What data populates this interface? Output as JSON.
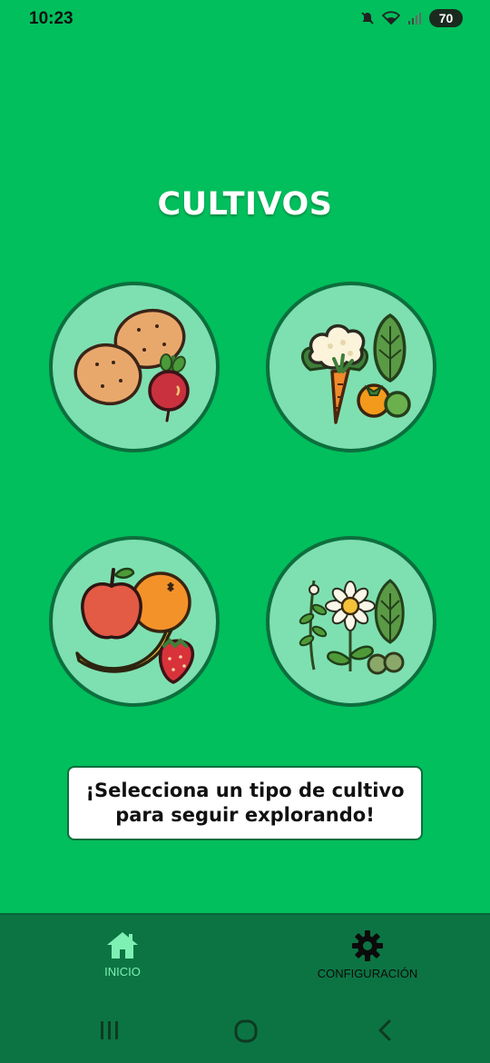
{
  "status_bar": {
    "time": "10:23",
    "battery": "70"
  },
  "page": {
    "title": "CULTIVOS",
    "message": "¡Selecciona un tipo de cultivo para seguir explorando!"
  },
  "categories": [
    {
      "id": "tuberculos",
      "icon": "potatoes-beet-icon"
    },
    {
      "id": "hortalizas",
      "icon": "vegetables-icon"
    },
    {
      "id": "frutas",
      "icon": "fruits-icon"
    },
    {
      "id": "aromaticas",
      "icon": "herbs-flowers-icon"
    }
  ],
  "bottom_nav": {
    "home_label": "INICIO",
    "settings_label": "CONFIGURACIÓN"
  },
  "colors": {
    "background": "#00bf5c",
    "circle_fill": "#7ee0b0",
    "circle_border": "#0d6e3d",
    "nav_background": "#0c7443",
    "nav_active": "#7ef0b4"
  }
}
